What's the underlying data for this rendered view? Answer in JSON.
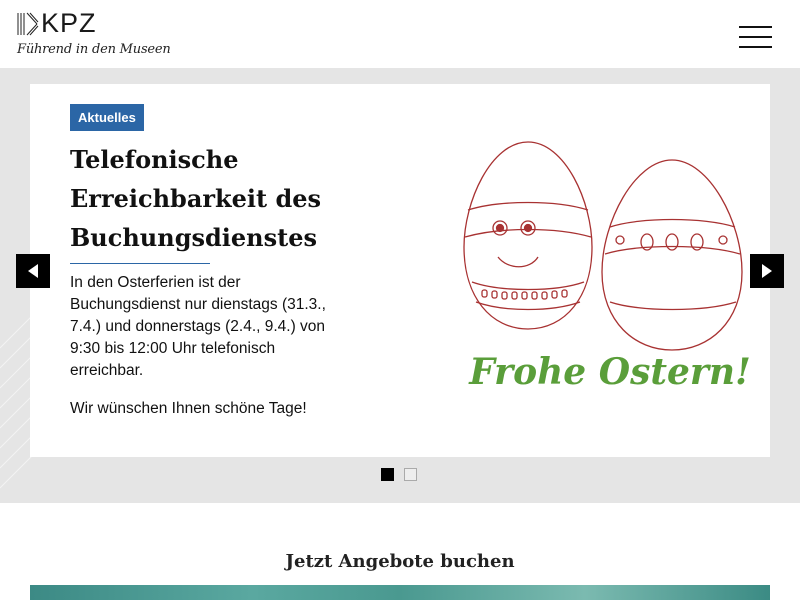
{
  "header": {
    "logo_text": "KPZ",
    "tagline": "Führend in den Museen",
    "menu_icon": "hamburger-menu-icon"
  },
  "slider": {
    "badge": "Aktuelles",
    "title": "Telefonische Erreichbarkeit des Buchungsdienstes",
    "body": [
      "In den Osterferien ist der Buchungsdienst nur dienstags (31.3., 7.4.) und donnerstags (2.4., 9.4.) von 9:30 bis 12:00 Uhr telefonisch erreichbar.",
      "Wir wünschen Ihnen schöne Tage!"
    ],
    "image_caption": "Frohe Ostern!",
    "prev_icon": "arrow-left-icon",
    "next_icon": "arrow-right-icon",
    "dot_count": 2,
    "active_dot": 1
  },
  "offers": {
    "heading": "Jetzt Angebote buchen"
  },
  "colors": {
    "accent": "#2b66a6",
    "egg_stroke": "#a83232",
    "caption_green": "#5a9e3a",
    "slider_bg": "#e5e5e5"
  }
}
